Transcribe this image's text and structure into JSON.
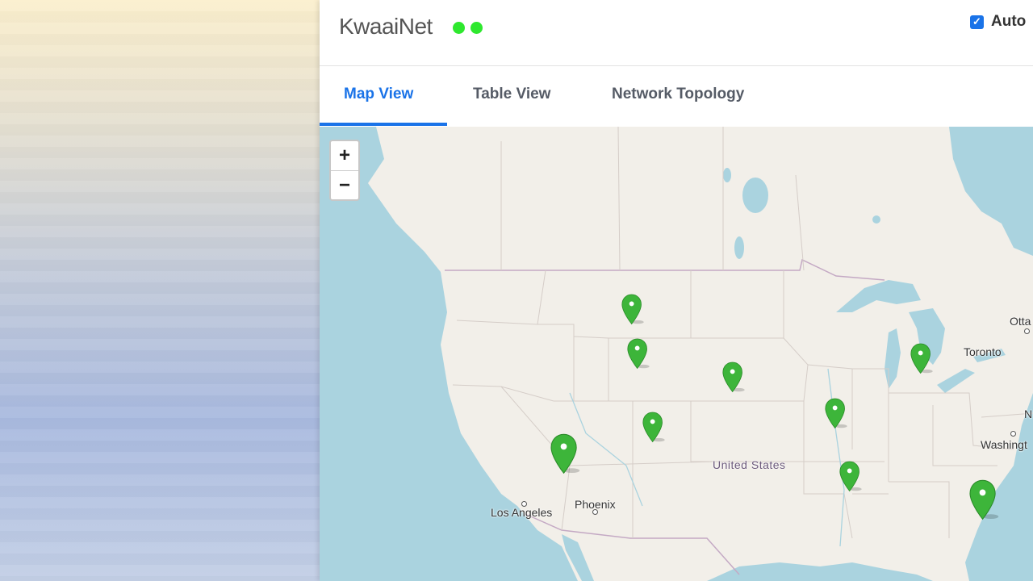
{
  "header": {
    "app_title": "KwaaiNet",
    "status_dots": [
      "#2ee82e",
      "#2ee82e"
    ],
    "auto_label": "Auto",
    "auto_checked": true
  },
  "tabs": [
    {
      "label": "Map View",
      "active": true
    },
    {
      "label": "Table View",
      "active": false
    },
    {
      "label": "Network Topology",
      "active": false
    }
  ],
  "colors": {
    "accent": "#1a73e8",
    "marker_green": "#3db53a",
    "water": "#aad3df",
    "land": "#f2efe9"
  },
  "map": {
    "zoom_in_label": "+",
    "zoom_out_label": "−",
    "labels": {
      "country": "United States",
      "city_toronto": "Toronto",
      "city_ottawa": "Otta",
      "city_washington": "Washingt",
      "city_phoenix": "Phoenix",
      "city_la": "Los Angeles",
      "cut_n": "N"
    },
    "marker_icon": "map-pin-icon",
    "marker_count": 10
  }
}
